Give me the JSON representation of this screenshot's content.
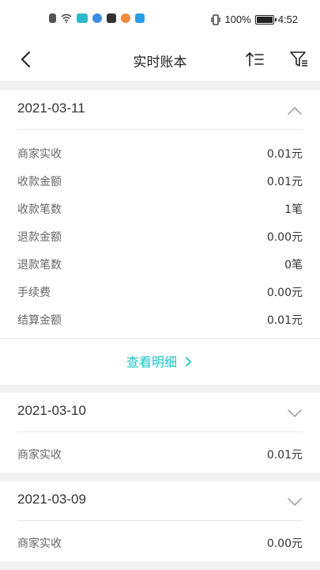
{
  "status_bar": {
    "battery_percent": "100%",
    "time": "4:52"
  },
  "nav": {
    "title": "实时账本"
  },
  "records": [
    {
      "date": "2021-03-11",
      "expanded": true,
      "rows": [
        {
          "label": "商家实收",
          "value": "0.01元"
        },
        {
          "label": "收款金额",
          "value": "0.01元"
        },
        {
          "label": "收款笔数",
          "value": "1笔"
        },
        {
          "label": "退款金额",
          "value": "0.00元"
        },
        {
          "label": "退款笔数",
          "value": "0笔"
        },
        {
          "label": "手续费",
          "value": "0.00元"
        },
        {
          "label": "结算金额",
          "value": "0.01元"
        }
      ],
      "detail_link": "查看明细"
    },
    {
      "date": "2021-03-10",
      "expanded": false,
      "rows": [
        {
          "label": "商家实收",
          "value": "0.01元"
        }
      ]
    },
    {
      "date": "2021-03-09",
      "expanded": false,
      "rows": [
        {
          "label": "商家实收",
          "value": "0.00元"
        }
      ]
    }
  ],
  "colors": {
    "accent": "#1cc3c9",
    "background": "#f2f2f2"
  }
}
